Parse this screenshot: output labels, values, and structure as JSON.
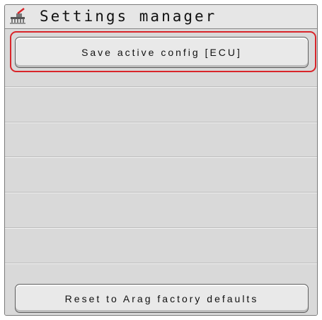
{
  "header": {
    "title": "Settings manager",
    "icon": "sprayer-settings-icon"
  },
  "buttons": {
    "save": "Save active config [ECU]",
    "reset": "Reset to Arag factory defaults"
  },
  "colors": {
    "focus": "#d9252a",
    "icon_red": "#d9252a"
  }
}
